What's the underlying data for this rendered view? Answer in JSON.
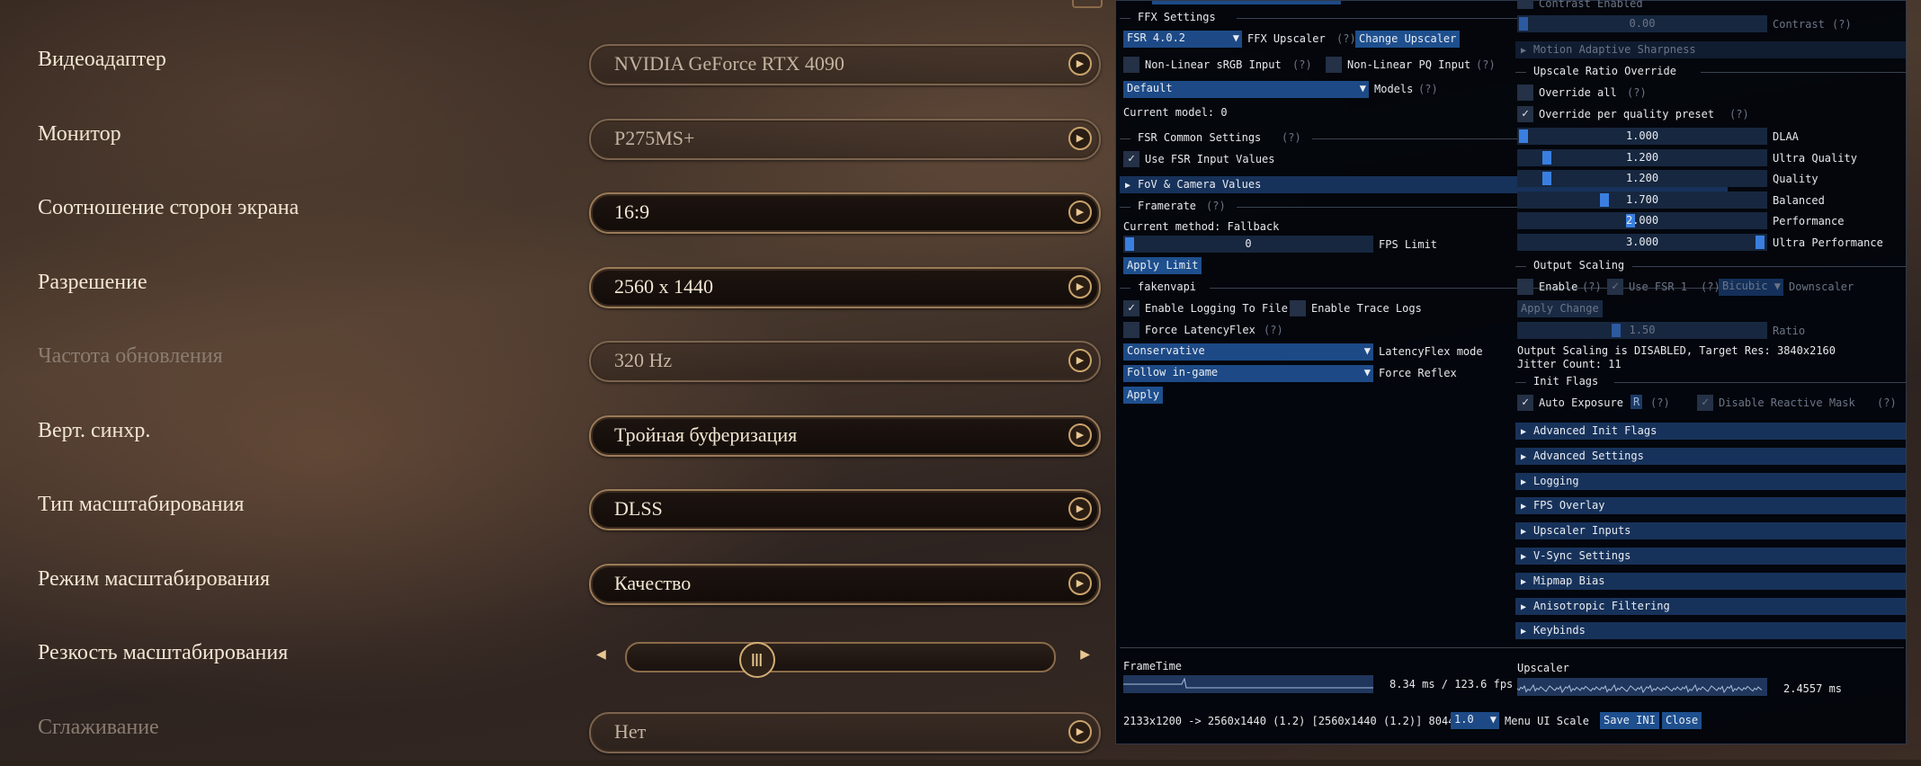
{
  "game": {
    "settings": [
      {
        "label": "Видеоадаптер",
        "value": "NVIDIA GeForce RTX 4090",
        "style": "soft"
      },
      {
        "label": "Монитор",
        "value": "P275MS+",
        "style": "soft"
      },
      {
        "label": "Соотношение сторон экрана",
        "value": "16:9",
        "style": "dark"
      },
      {
        "label": "Разрешение",
        "value": "2560 x 1440",
        "style": "dark"
      },
      {
        "label": "Частота обновления",
        "value": "320 Hz",
        "style": "soft",
        "disabled": true
      },
      {
        "label": "Верт. синхр.",
        "value": "Тройная буферизация",
        "style": "dark"
      },
      {
        "label": "Тип масштабирования",
        "value": "DLSS",
        "style": "dark"
      },
      {
        "label": "Режим масштабирования",
        "value": "Качество",
        "style": "dark"
      },
      {
        "label": "Резкость масштабирования",
        "slider": true,
        "slider_level": 0.3
      },
      {
        "label": "Сглаживание",
        "value": "Нет",
        "style": "soft",
        "disabled": true
      }
    ]
  },
  "ov": {
    "ffx": {
      "title": "FFX Settings",
      "upscaler_combo": "FSR 4.0.2",
      "upscaler_label": "FFX Upscaler",
      "hint": "(?)",
      "change_btn": "Change Upscaler",
      "nonlinear_srgb": "Non-Linear sRGB Input",
      "nonlinear_pq": "Non-Linear PQ Input",
      "models_combo": "Default",
      "models_label": "Models",
      "current_model": "Current model: 0"
    },
    "fsr_common": {
      "title": "FSR Common Settings",
      "use_input": "Use FSR Input Values",
      "fov_header": "FoV & Camera Values"
    },
    "framerate": {
      "title": "Framerate",
      "method": "Current method: Fallback",
      "fps_value": "0",
      "fps_label": "FPS Limit",
      "apply_btn": "Apply Limit"
    },
    "fakenvapi": {
      "title": "fakenvapi",
      "enable_logging": "Enable Logging To File",
      "enable_trace": "Enable Trace Logs",
      "force_latencyflex": "Force LatencyFlex",
      "lfx_combo": "Conservative",
      "lfx_label": "LatencyFlex mode",
      "reflex_combo": "Follow in-game",
      "reflex_label": "Force Reflex",
      "apply_btn": "Apply"
    },
    "right": {
      "contrast_enabled": "Contrast Enabled",
      "contrast_value": "0.00",
      "contrast_label": "Contrast",
      "motion_header": "Motion Adaptive Sharpness",
      "ratio_title": "Upscale Ratio Override",
      "override_all": "Override all",
      "override_preset": "Override per quality preset",
      "ratios": [
        {
          "value": "1.000",
          "label": "DLAA"
        },
        {
          "value": "1.200",
          "label": "Ultra Quality"
        },
        {
          "value": "1.200",
          "label": "Quality"
        },
        {
          "value": "1.700",
          "label": "Balanced"
        },
        {
          "value": "2.000",
          "label": "Performance"
        },
        {
          "value": "3.000",
          "label": "Ultra Performance"
        }
      ],
      "output_title": "Output Scaling",
      "enable": "Enable",
      "use_fsr1": "Use FSR 1",
      "downscaler_combo": "Bicubic",
      "downscaler_label": "Downscaler",
      "apply_change": "Apply Change",
      "ratio_value": "1.50",
      "ratio_label": "Ratio",
      "status_line1": "Output Scaling is DISABLED, Target Res: 3840x2160",
      "status_line2": "Jitter Count: 11",
      "init_title": "Init Flags",
      "auto_exposure": "Auto Exposure",
      "auto_exposure_key": "R",
      "disable_reactive": "Disable Reactive Mask",
      "headers": [
        "Advanced Init Flags",
        "Advanced Settings",
        "Logging",
        "FPS Overlay",
        "Upscaler Inputs",
        "V-Sync Settings",
        "Mipmap Bias",
        "Anisotropic Filtering",
        "Keybinds"
      ]
    },
    "bottom": {
      "frametime_label": "FrameTime",
      "frametime_value": "8.34 ms / 123.6 fps",
      "upscaler_label": "Upscaler",
      "upscaler_value": "2.4557 ms",
      "res_line": "2133x1200 -> 2560x1440 (1.2) [2560x1440 (1.2)] 8044",
      "scale_combo": "1.0",
      "scale_label": "Menu UI Scale",
      "save_btn": "Save INI",
      "close_btn": "Close"
    }
  },
  "colors": {
    "accent": "#1e4f8e",
    "gold": "#c9a36c"
  }
}
